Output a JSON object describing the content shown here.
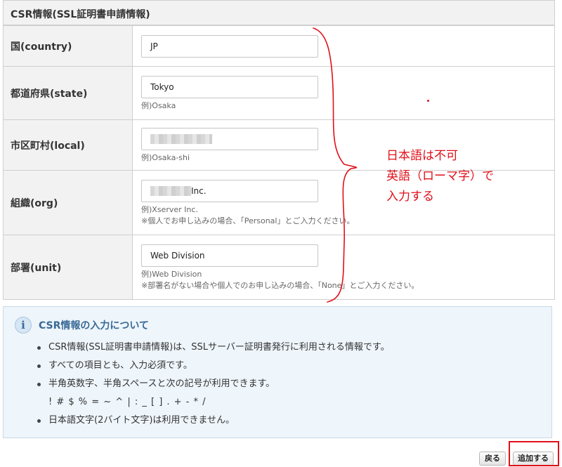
{
  "section": {
    "title": "CSR情報(SSL証明書申請情報)"
  },
  "rows": [
    {
      "label": "国(country)",
      "value": "JP",
      "hint": "",
      "hint2": ""
    },
    {
      "label": "都道府県(state)",
      "value": "Tokyo",
      "hint": "例)Osaka",
      "hint2": ""
    },
    {
      "label": "市区町村(local)",
      "value": "",
      "hint": "例)Osaka-shi",
      "hint2": ""
    },
    {
      "label": "組織(org)",
      "value": "Inc.",
      "hint": "例)Xserver Inc.",
      "hint2": "※個人でお申し込みの場合、「Personal」とご入力ください。"
    },
    {
      "label": "部署(unit)",
      "value": "Web Division",
      "hint": "例)Web Division",
      "hint2": "※部署名がない場合や個人でのお申し込みの場合、「None」とご入力ください。"
    }
  ],
  "info": {
    "title": "CSR情報の入力について",
    "icon": "info-icon",
    "items": [
      "CSR情報(SSL証明書申請情報)は、SSLサーバー証明書発行に利用される情報です。",
      "すべての項目とも、入力必須です。",
      "半角英数字、半角スペースと次の記号が利用できます。",
      "! # $ % = ~ ^ | : _ [ ] . + - * /",
      "日本語文字(2バイト文字)は利用できません。"
    ]
  },
  "buttons": {
    "back": "戻る",
    "add": "追加する"
  },
  "annotation": {
    "lines": [
      "日本語は不可",
      "英語（ローマ字）で",
      "入力する"
    ],
    "color": "#e0101a"
  }
}
